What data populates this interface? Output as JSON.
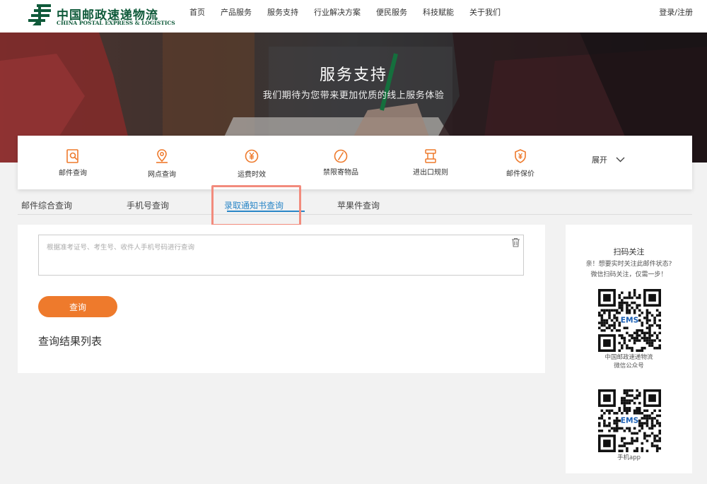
{
  "header": {
    "logo_cn": "中国邮政速递物流",
    "logo_en": "CHINA POSTAL EXPRESS & LOGISTICS",
    "nav": [
      "首页",
      "产品服务",
      "服务支持",
      "行业解决方案",
      "便民服务",
      "科技赋能",
      "关于我们"
    ],
    "login": "登录/注册"
  },
  "banner": {
    "title": "服务支持",
    "subtitle": "我们期待为您带来更加优质的线上服务体验"
  },
  "services": {
    "items": [
      {
        "label": "邮件查询",
        "icon": "mail-search-icon"
      },
      {
        "label": "网点查询",
        "icon": "location-pin-icon"
      },
      {
        "label": "运费时效",
        "icon": "yuan-clock-icon"
      },
      {
        "label": "禁限寄物品",
        "icon": "prohibited-icon"
      },
      {
        "label": "进出口规则",
        "icon": "import-export-icon"
      },
      {
        "label": "邮件保价",
        "icon": "shield-yuan-icon"
      }
    ],
    "expand": "展开"
  },
  "tabs": {
    "items": [
      "邮件综合查询",
      "手机号查询",
      "录取通知书查询",
      "苹果件查询"
    ],
    "active_index": 2
  },
  "query": {
    "placeholder": "根据准考证号、考生号、收件人手机号码进行查询",
    "value": "",
    "button": "查询",
    "result_title": "查询结果列表"
  },
  "sidebar": {
    "title": "扫码关注",
    "desc_line1": "亲！想要实时关注此邮件状态?",
    "desc_line2": "微信扫码关注，仅需一步！",
    "qr1_caption_line1": "中国邮政速递物流",
    "qr1_caption_line2": "微信公众号",
    "qr2_caption": "手机app",
    "qr_center_label": "EMS"
  },
  "colors": {
    "accent_orange": "#ee7a2c",
    "active_tab_blue": "#2a86c7",
    "logo_green": "#0f5a3a",
    "highlight_salmon": "#f28b7d"
  }
}
